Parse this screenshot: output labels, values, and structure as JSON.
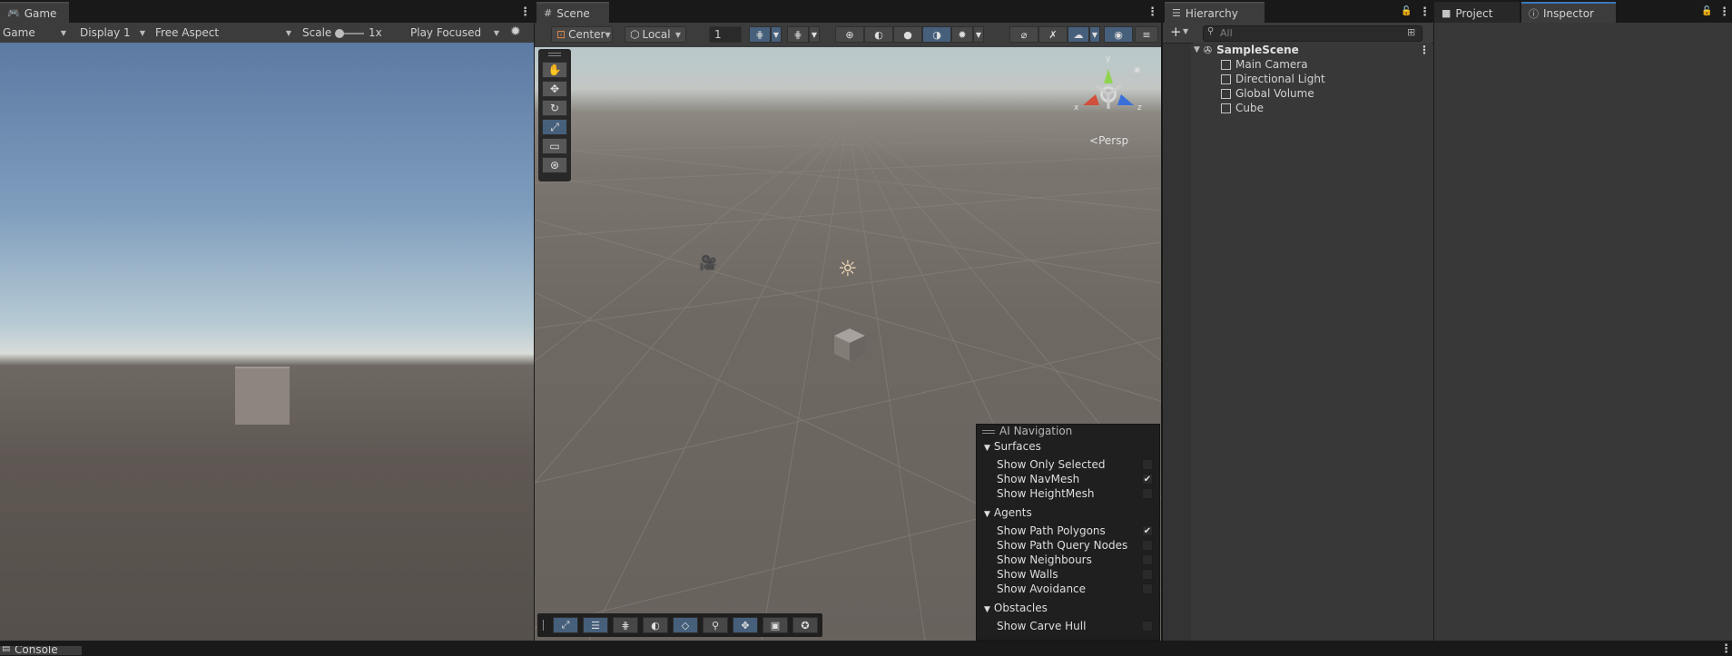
{
  "game": {
    "tab_label": "Game",
    "mode_label": "Game",
    "display_label": "Display 1",
    "aspect_label": "Free Aspect",
    "scale_label": "Scale",
    "scale_value": "1x",
    "play_mode_label": "Play Focused"
  },
  "scene": {
    "tab_label": "Scene",
    "pivot_label": "Center",
    "space_label": "Local",
    "grid_snap_value": "1",
    "persp_label": "Persp",
    "gizmo_y_label": "y",
    "gizmo_x_label": "x",
    "gizmo_z_label": "z"
  },
  "ai_nav": {
    "title": "AI Navigation",
    "sections": [
      {
        "label": "Surfaces",
        "items": [
          {
            "label": "Show Only Selected",
            "checked": false
          },
          {
            "label": "Show NavMesh",
            "checked": true
          },
          {
            "label": "Show HeightMesh",
            "checked": false
          }
        ]
      },
      {
        "label": "Agents",
        "items": [
          {
            "label": "Show Path Polygons",
            "checked": true
          },
          {
            "label": "Show Path Query Nodes",
            "checked": false
          },
          {
            "label": "Show Neighbours",
            "checked": false
          },
          {
            "label": "Show Walls",
            "checked": false
          },
          {
            "label": "Show Avoidance",
            "checked": false
          }
        ]
      },
      {
        "label": "Obstacles",
        "items": [
          {
            "label": "Show Carve Hull",
            "checked": false
          }
        ]
      }
    ]
  },
  "hierarchy": {
    "tab_label": "Hierarchy",
    "search_placeholder": "All",
    "scene_name": "SampleScene",
    "items": [
      "Main Camera",
      "Directional Light",
      "Global Volume",
      "Cube"
    ]
  },
  "project": {
    "tab_label": "Project"
  },
  "inspector": {
    "tab_label": "Inspector"
  },
  "console": {
    "tab_label": "Console"
  },
  "icons": {
    "kebab": "⋮",
    "check": "✔",
    "sun": "☼",
    "lock": "🔒"
  }
}
